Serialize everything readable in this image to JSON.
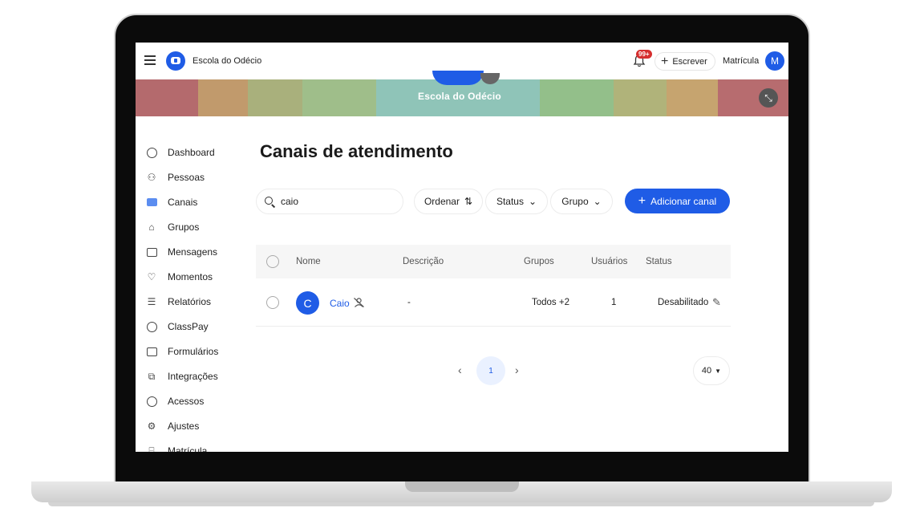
{
  "header": {
    "school_name": "Escola do Odécio",
    "notification_count": "99+",
    "write_label": "Escrever",
    "matricula_label": "Matrícula",
    "avatar_initial": "M"
  },
  "banner": {
    "title": "Escola do Odécio",
    "colors": [
      "#b46a6d",
      "#c19a6c",
      "#a9b07c",
      "#9fbe8a",
      "#8fc4b8",
      "#93bf8a",
      "#b0b37a",
      "#c6a46f",
      "#b76c6f"
    ]
  },
  "sidebar": {
    "items": [
      {
        "label": "Dashboard",
        "icon": "gauge-icon"
      },
      {
        "label": "Pessoas",
        "icon": "people-icon"
      },
      {
        "label": "Canais",
        "icon": "chat-icon",
        "active": true
      },
      {
        "label": "Grupos",
        "icon": "graduation-cap-icon"
      },
      {
        "label": "Mensagens",
        "icon": "envelope-icon"
      },
      {
        "label": "Momentos",
        "icon": "heart-icon"
      },
      {
        "label": "Relatórios",
        "icon": "list-icon"
      },
      {
        "label": "ClassPay",
        "icon": "coin-icon"
      },
      {
        "label": "Formulários",
        "icon": "form-icon"
      },
      {
        "label": "Integrações",
        "icon": "puzzle-icon"
      },
      {
        "label": "Acessos",
        "icon": "globe-icon"
      },
      {
        "label": "Ajustes",
        "icon": "gear-icon"
      },
      {
        "label": "Matrícula",
        "icon": "cart-icon"
      }
    ]
  },
  "main": {
    "title": "Canais de atendimento",
    "search_value": "caio",
    "sort_label": "Ordenar",
    "status_filter_label": "Status",
    "group_filter_label": "Grupo",
    "add_button_label": "Adicionar canal",
    "columns": [
      "Nome",
      "Descrição",
      "Grupos",
      "Usuários",
      "Status"
    ],
    "rows": [
      {
        "initial": "C",
        "name": "Caio",
        "description": "-",
        "groups": "Todos +2",
        "users": "1",
        "status": "Desabilitado"
      }
    ],
    "pagination": {
      "current_page": "1",
      "page_size": "40"
    }
  }
}
